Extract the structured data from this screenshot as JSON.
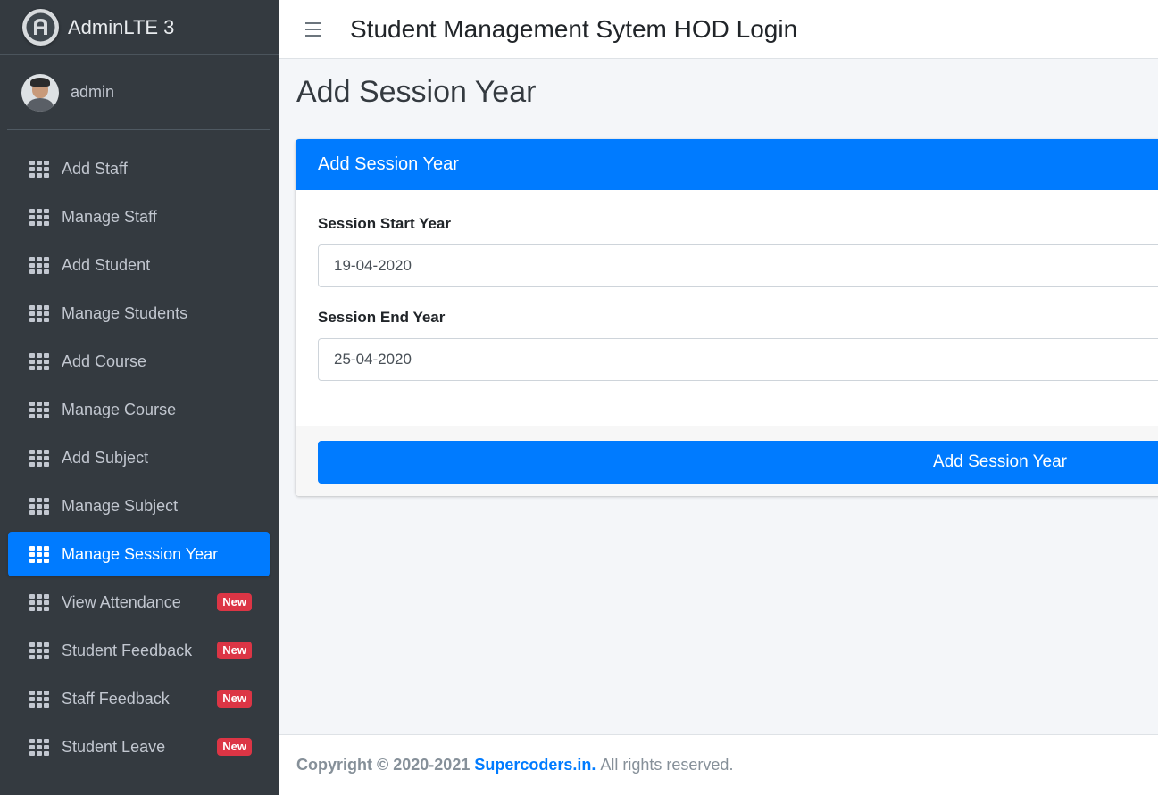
{
  "brand": {
    "name": "AdminLTE 3",
    "logo_icon": "adminlte-logo-icon"
  },
  "user": {
    "name": "admin",
    "avatar_icon": "user-avatar"
  },
  "sidebar": {
    "items": [
      {
        "label": "Add Staff",
        "icon": "th-grid-icon",
        "active": false,
        "badge": ""
      },
      {
        "label": "Manage Staff",
        "icon": "th-grid-icon",
        "active": false,
        "badge": ""
      },
      {
        "label": "Add Student",
        "icon": "th-grid-icon",
        "active": false,
        "badge": ""
      },
      {
        "label": "Manage Students",
        "icon": "th-grid-icon",
        "active": false,
        "badge": ""
      },
      {
        "label": "Add Course",
        "icon": "th-grid-icon",
        "active": false,
        "badge": ""
      },
      {
        "label": "Manage Course",
        "icon": "th-grid-icon",
        "active": false,
        "badge": ""
      },
      {
        "label": "Add Subject",
        "icon": "th-grid-icon",
        "active": false,
        "badge": ""
      },
      {
        "label": "Manage Subject",
        "icon": "th-grid-icon",
        "active": false,
        "badge": ""
      },
      {
        "label": "Manage Session Year",
        "icon": "th-grid-icon",
        "active": true,
        "badge": ""
      },
      {
        "label": "View Attendance",
        "icon": "th-grid-icon",
        "active": false,
        "badge": "New"
      },
      {
        "label": "Student Feedback",
        "icon": "th-grid-icon",
        "active": false,
        "badge": "New"
      },
      {
        "label": "Staff Feedback",
        "icon": "th-grid-icon",
        "active": false,
        "badge": "New"
      },
      {
        "label": "Student Leave",
        "icon": "th-grid-icon",
        "active": false,
        "badge": "New"
      }
    ]
  },
  "topbar": {
    "title": "Student Management Sytem HOD Login",
    "menu_icon": "hamburger-icon"
  },
  "page": {
    "title": "Add Session Year"
  },
  "form": {
    "header": "Add Session Year",
    "start_label": "Session Start Year",
    "start_value": "19-04-2020",
    "end_label": "Session End Year",
    "end_value": "25-04-2020",
    "submit_label": "Add Session Year"
  },
  "footer": {
    "copyright": "Copyright © 2020-2021",
    "link": "Supercoders.in.",
    "rights": "All rights reserved."
  },
  "colors": {
    "primary": "#007bff",
    "sidebar_bg": "#343a40",
    "badge_danger": "#dc3545",
    "content_bg": "#f4f6f9"
  }
}
